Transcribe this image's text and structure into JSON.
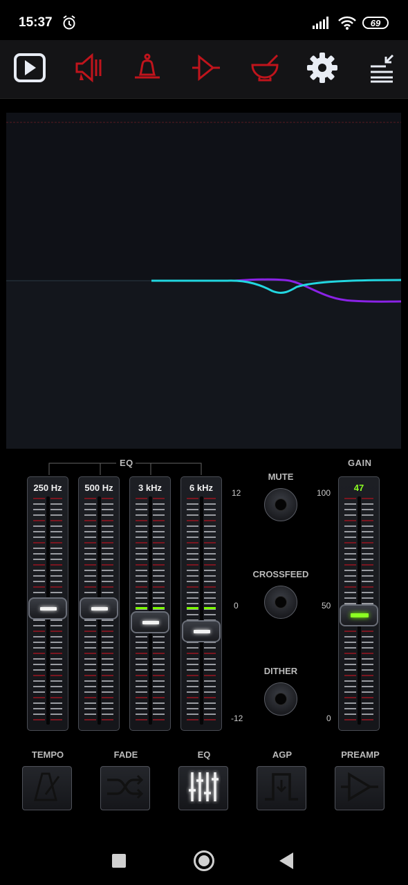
{
  "status": {
    "time": "15:37",
    "battery": "69"
  },
  "toolbar": {
    "icons": [
      "play-icon",
      "speaker-icon",
      "bell-icon",
      "amp-icon",
      "bowl-icon",
      "gear-icon",
      "menu-collapse-icon"
    ]
  },
  "eq": {
    "section_label": "EQ",
    "sliders": [
      {
        "label": "250 Hz",
        "value_db": 0
      },
      {
        "label": "500 Hz",
        "value_db": 0
      },
      {
        "label": "3 kHz",
        "value_db": -1.5
      },
      {
        "label": "6 kHz",
        "value_db": -2.5
      }
    ],
    "axis": {
      "top": "12",
      "mid": "0",
      "bottom": "-12"
    }
  },
  "controls": {
    "mute": "MUTE",
    "crossfeed": "CROSSFEED",
    "dither": "DITHER"
  },
  "gain": {
    "section_label": "GAIN",
    "value": "47",
    "axis": {
      "top": "100",
      "mid": "50",
      "bottom": "0"
    }
  },
  "bottom": {
    "tempo": "TEMPO",
    "fade": "FADE",
    "eq": "EQ",
    "agp": "AGP",
    "preamp": "PREAMP"
  },
  "colors": {
    "toolbar_red": "#c0141c",
    "curve_cyan": "#22d6e0",
    "curve_purple": "#8a22e6",
    "gain_green": "#8cff22"
  }
}
